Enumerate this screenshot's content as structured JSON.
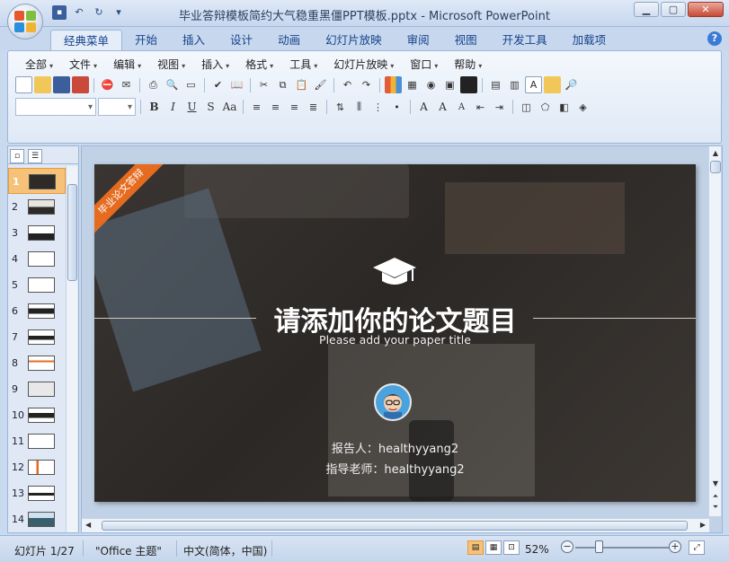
{
  "window": {
    "title": "毕业答辩模板简约大气稳重黑僵PPT模板.pptx - Microsoft PowerPoint",
    "controls": [
      "minimize",
      "maximize",
      "close"
    ]
  },
  "ribbon_tabs": [
    {
      "label": "经典菜单",
      "active": true
    },
    {
      "label": "开始"
    },
    {
      "label": "插入"
    },
    {
      "label": "设计"
    },
    {
      "label": "动画"
    },
    {
      "label": "幻灯片放映"
    },
    {
      "label": "审阅"
    },
    {
      "label": "视图"
    },
    {
      "label": "开发工具"
    },
    {
      "label": "加载项"
    }
  ],
  "classic_menu": [
    "全部",
    "文件",
    "编辑",
    "视图",
    "插入",
    "格式",
    "工具",
    "幻灯片放映",
    "窗口",
    "帮助"
  ],
  "slides_pane": {
    "numbers": [
      "1",
      "2",
      "3",
      "4",
      "5",
      "6",
      "7",
      "8",
      "9",
      "10",
      "11",
      "12",
      "13",
      "14"
    ],
    "selected": "1"
  },
  "slide": {
    "banner": "毕业论文答辩",
    "title": "请添加你的论文题目",
    "subtitle": "Please add your paper title",
    "reporter": "报告人：healthyyang2",
    "advisor": "指导老师：healthyyang2"
  },
  "status": {
    "slide_counter": "幻灯片 1/27",
    "theme": "\"Office 主题\"",
    "language": "中文(简体，中国)",
    "zoom": "52%"
  },
  "colors": {
    "accent_orange": "#e56b1f",
    "ribbon_blue": "#15428b"
  }
}
